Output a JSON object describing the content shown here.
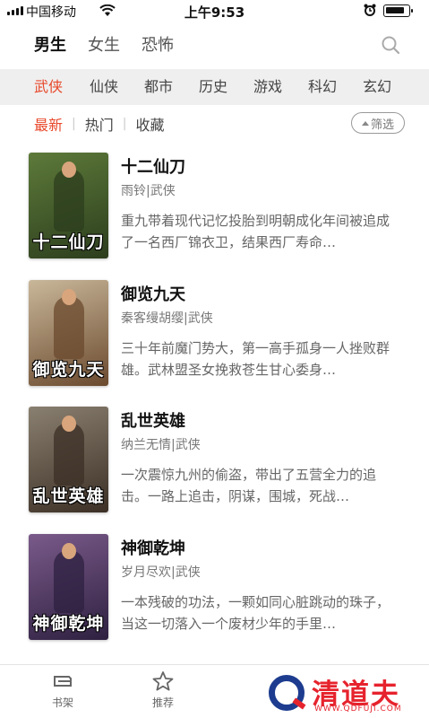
{
  "status_bar": {
    "carrier": "中国移动",
    "time": "上午9:53"
  },
  "gender_tabs": [
    {
      "label": "男生",
      "active": true
    },
    {
      "label": "女生",
      "active": false
    },
    {
      "label": "恐怖",
      "active": false
    }
  ],
  "categories": [
    {
      "label": "武侠",
      "active": true
    },
    {
      "label": "仙侠",
      "active": false
    },
    {
      "label": "都市",
      "active": false
    },
    {
      "label": "历史",
      "active": false
    },
    {
      "label": "游戏",
      "active": false
    },
    {
      "label": "科幻",
      "active": false
    },
    {
      "label": "玄幻",
      "active": false
    }
  ],
  "sort_tabs": [
    {
      "label": "最新",
      "active": true
    },
    {
      "label": "热门",
      "active": false
    },
    {
      "label": "收藏",
      "active": false
    }
  ],
  "filter": {
    "label": "筛选"
  },
  "books": [
    {
      "title": "十二仙刀",
      "meta": "雨铃|武侠",
      "desc": "重九带着现代记忆投胎到明朝成化年间被追成了一名西厂锦衣卫，结果西厂寿命…",
      "cover_text": "十二仙刀",
      "cover_colors": [
        "#5d7a3a",
        "#2c3d1d"
      ]
    },
    {
      "title": "御览九天",
      "meta": "秦客缦胡缨|武侠",
      "desc": "三十年前魔门势大，第一高手孤身一人挫败群雄。武林盟圣女挽救苍生甘心委身…",
      "cover_text": "御览九天",
      "cover_colors": [
        "#c9b79a",
        "#6b4a2e"
      ]
    },
    {
      "title": "乱世英雄",
      "meta": "纳兰无情|武侠",
      "desc": "一次震惊九州的偷盗，带出了五营全力的追击。一路上追击，阴谋，围城，死战…",
      "cover_text": "乱世英雄",
      "cover_colors": [
        "#8a8070",
        "#3c2f25"
      ]
    },
    {
      "title": "神御乾坤",
      "meta": "岁月尽欢|武侠",
      "desc": "一本残破的功法，一颗如同心脏跳动的珠子，当这一切落入一个废材少年的手里…",
      "cover_text": "神御乾坤",
      "cover_colors": [
        "#7a5a8a",
        "#2e2040"
      ]
    }
  ],
  "bottom_nav": [
    {
      "label": "书架",
      "icon": "bookshelf-icon"
    },
    {
      "label": "推荐",
      "icon": "star-icon"
    }
  ],
  "watermark": {
    "text": "清道夫",
    "url": "WWW.QDFUJI.COM"
  },
  "colors": {
    "accent": "#e8482b",
    "category_bg": "#efefef",
    "watermark_red": "#e6232d",
    "watermark_blue": "#1d3c8f"
  }
}
